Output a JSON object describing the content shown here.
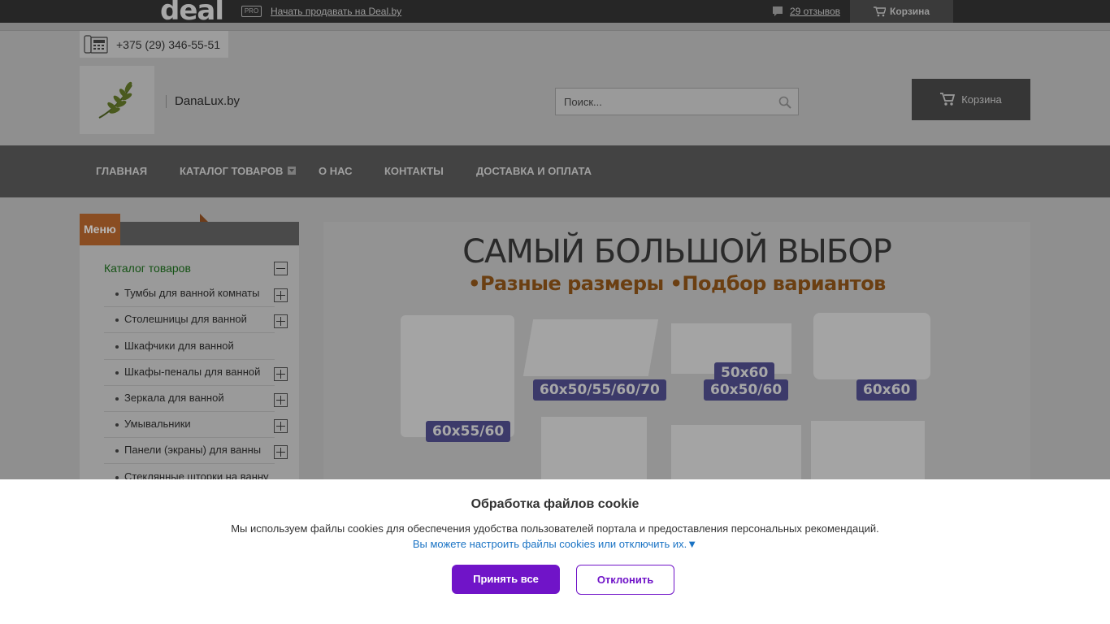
{
  "topbar": {
    "logo": "deal",
    "pro_badge": "PRO",
    "sell_link": "Начать продавать на Deal.by",
    "reviews": "29 отзывов",
    "cart": "Корзина"
  },
  "contact": {
    "phone": "+375 (29) 346-55-51"
  },
  "header": {
    "site_name": "DanaLux.by",
    "search_placeholder": "Поиск...",
    "cart_label": "Корзина"
  },
  "nav": {
    "items": [
      {
        "label": "ГЛАВНАЯ"
      },
      {
        "label": "КАТАЛОГ ТОВАРОВ"
      },
      {
        "label": "О НАС"
      },
      {
        "label": "КОНТАКТЫ"
      },
      {
        "label": "ДОСТАВКА И ОПЛАТА"
      }
    ]
  },
  "sidebar": {
    "tab_label": "Меню",
    "catalog_title": "Каталог товаров",
    "items": [
      {
        "label": "Тумбы для ванной комнаты"
      },
      {
        "label": "Столешницы для ванной"
      },
      {
        "label": "Шкафчики для ванной"
      },
      {
        "label": "Шкафы-пеналы для ванной"
      },
      {
        "label": "Зеркала для ванной"
      },
      {
        "label": "Умывальники"
      },
      {
        "label": "Панели (экраны) для ванны"
      },
      {
        "label": "Стеклянные шторки на ванну"
      }
    ]
  },
  "banner": {
    "title": "САМЫЙ БОЛЬШОЙ ВЫБОР",
    "subtitle": "•Разные размеры •Подбор вариантов",
    "tags": [
      "60x55/60",
      "60x50/55/60/70",
      "50x60",
      "60x50/60",
      "60x60"
    ]
  },
  "cookie": {
    "title": "Обработка файлов cookie",
    "text": "Мы используем файлы cookies для обеспечения удобства пользователей портала и предоставления персональных рекомендаций.",
    "link": "Вы можете настроить файлы cookies или отключить их.▼",
    "accept": "Принять все",
    "decline": "Отклонить"
  },
  "colors": {
    "accent_purple": "#7014c8",
    "link_blue": "#1a73c4",
    "catalog_green": "#145214"
  }
}
